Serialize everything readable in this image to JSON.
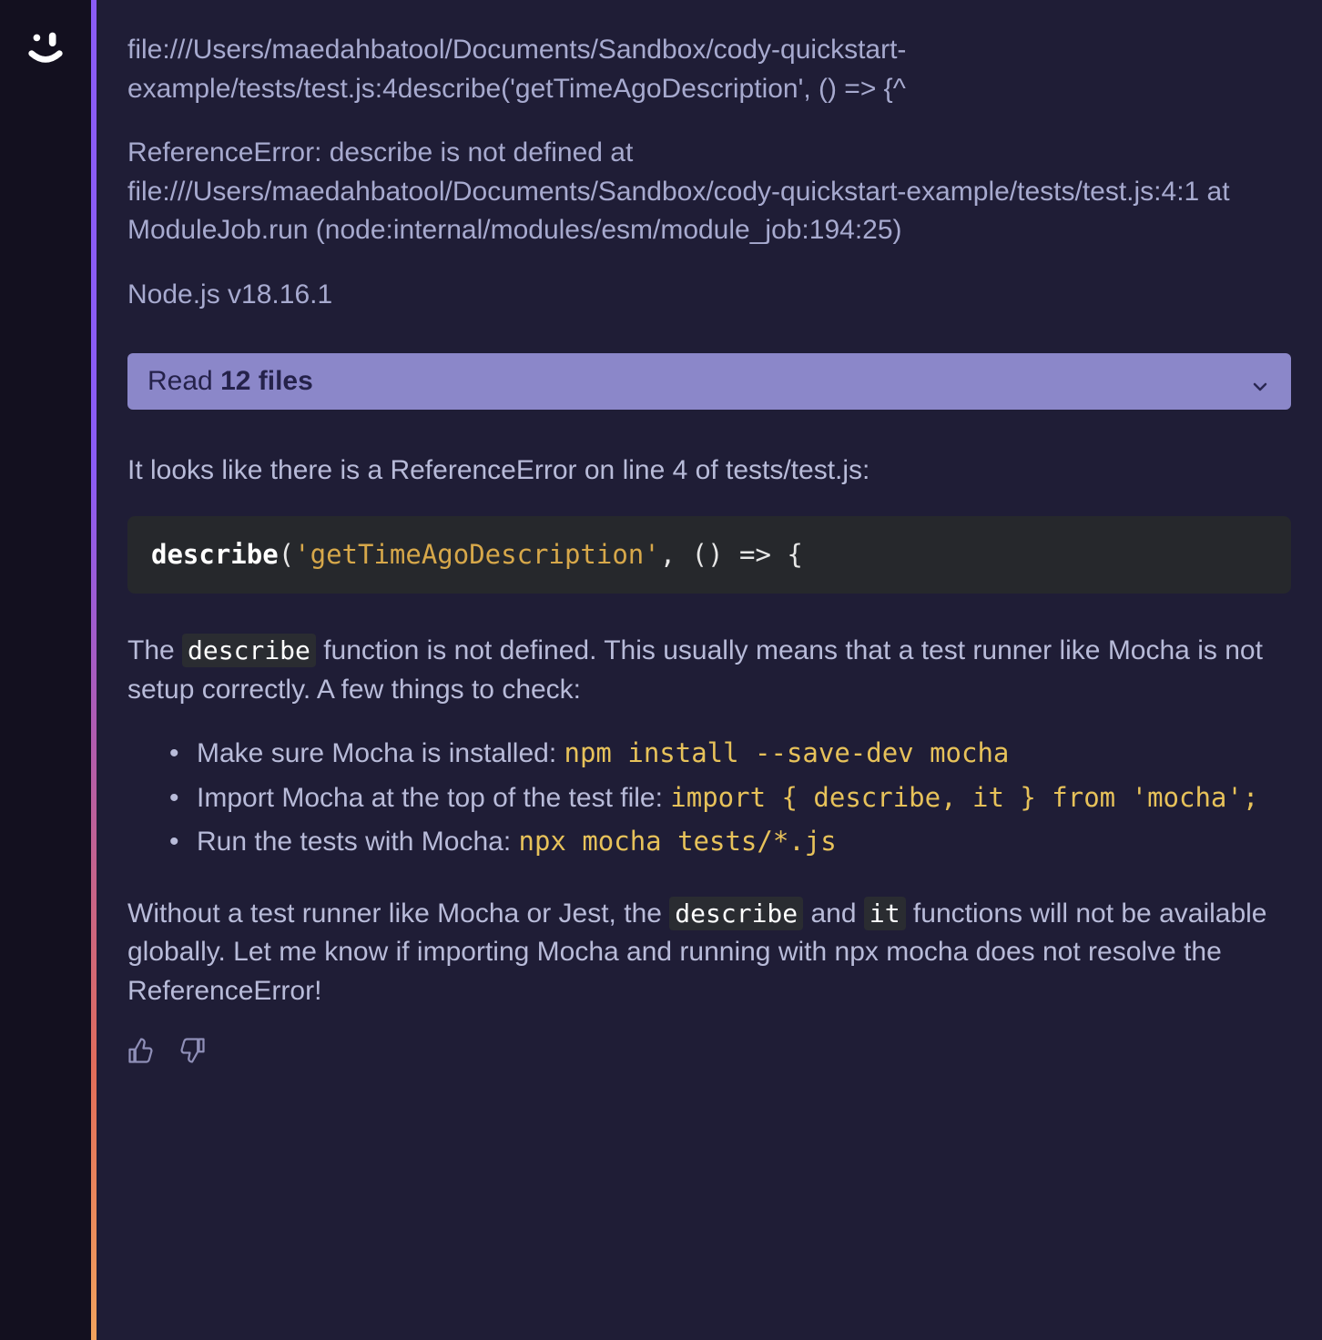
{
  "user_message": {
    "line1": "file:///Users/maedahbatool/Documents/Sandbox/cody-quickstart-example/tests/test.js:4describe('getTimeAgoDescription', () => {^",
    "line2": "ReferenceError: describe is not defined at file:///Users/maedahbatool/Documents/Sandbox/cody-quickstart-example/tests/test.js:4:1 at ModuleJob.run (node:internal/modules/esm/module_job:194:25)",
    "line3": "Node.js v18.16.1"
  },
  "context_pill": {
    "prefix": "Read ",
    "bold": "12 files"
  },
  "assistant": {
    "intro": "It looks like there is a ReferenceError on line 4 of tests/test.js:",
    "code": {
      "fn": "describe",
      "open": "(",
      "str": "'getTimeAgoDescription'",
      "rest": ", () => {"
    },
    "para2_a": "The ",
    "para2_code": "describe",
    "para2_b": " function is not defined. This usually means that a test runner like Mocha is not setup correctly. A few things to check:",
    "bullets": [
      {
        "text": "Make sure Mocha is installed: ",
        "cmd": "npm install --save-dev mocha"
      },
      {
        "text": "Import Mocha at the top of the test file: ",
        "cmd": "import { describe, it } from 'mocha';"
      },
      {
        "text": "Run the tests with Mocha: ",
        "cmd": "npx mocha tests/*.js"
      }
    ],
    "outro_a": "Without a test runner like Mocha or Jest, the ",
    "outro_code1": "describe",
    "outro_mid": " and ",
    "outro_code2": "it",
    "outro_b": " functions will not be available globally. Let me know if importing Mocha and running with npx mocha does not resolve the ReferenceError!"
  }
}
